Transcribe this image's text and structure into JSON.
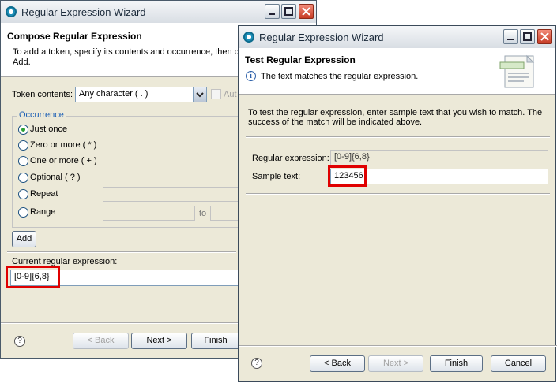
{
  "back_window": {
    "title": "Regular Expression Wizard",
    "header_title": "Compose Regular Expression",
    "header_desc_line1": "To add a token, specify its contents and occurrence, then clic",
    "header_desc_line2": "Add.",
    "token_label": "Token contents:",
    "token_value": "Any character ( . )",
    "checkbox_label": "Aut",
    "occurrence_title": "Occurrence",
    "radios": [
      {
        "label": "Just once",
        "selected": true
      },
      {
        "label": "Zero or more ( * )",
        "selected": false
      },
      {
        "label": "One or more ( + )",
        "selected": false
      },
      {
        "label": "Optional ( ? )",
        "selected": false
      },
      {
        "label": "Repeat",
        "selected": false
      },
      {
        "label": "Range",
        "selected": false
      }
    ],
    "range_to": "to",
    "add_label": "Add",
    "current_label": "Current regular expression:",
    "current_value": "[0-9]{6,8}",
    "back_label": "< Back",
    "next_label": "Next >",
    "finish_label": "Finish"
  },
  "front_window": {
    "title": "Regular Expression Wizard",
    "header_title": "Test Regular Expression",
    "header_message": "The text matches the regular expression.",
    "instructions_line1": "To test the regular expression, enter sample text that you wish to match.  The",
    "instructions_line2": "success of the match will be indicated above.",
    "regex_label": "Regular expression:",
    "regex_value": "[0-9]{6,8}",
    "sample_label": "Sample text:",
    "sample_value": "123456",
    "back_label": "< Back",
    "next_label": "Next >",
    "finish_label": "Finish",
    "cancel_label": "Cancel"
  },
  "colors": {
    "highlight": "#e00000",
    "selected_radio": "#2aa034"
  }
}
